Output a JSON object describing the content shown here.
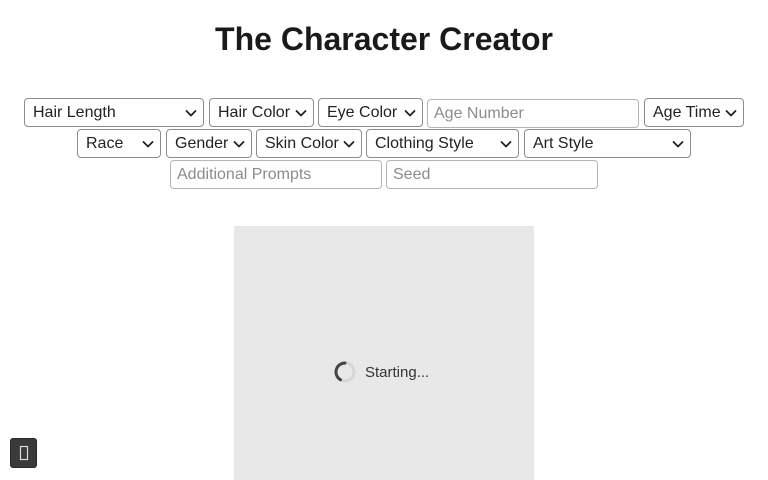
{
  "header": {
    "title": "The Character Creator"
  },
  "controls": {
    "hair_length": "Hair Length",
    "hair_color": "Hair Color",
    "eye_color": "Eye Color",
    "age_number_placeholder": "Age Number",
    "age_time": "Age Time",
    "race": "Race",
    "gender": "Gender",
    "skin_color": "Skin Color",
    "clothing_style": "Clothing Style",
    "art_style": "Art Style",
    "additional_prompts_placeholder": "Additional Prompts",
    "seed_placeholder": "Seed"
  },
  "preview": {
    "status_text": "Starting...",
    "background_color": "#e8e8e8"
  },
  "icons": {
    "select_arrow": "chevron-down-icon",
    "status": "loading-spinner-icon",
    "corner_button": "menu-icon"
  },
  "colors": {
    "corner_button": "#3a3a3a"
  }
}
